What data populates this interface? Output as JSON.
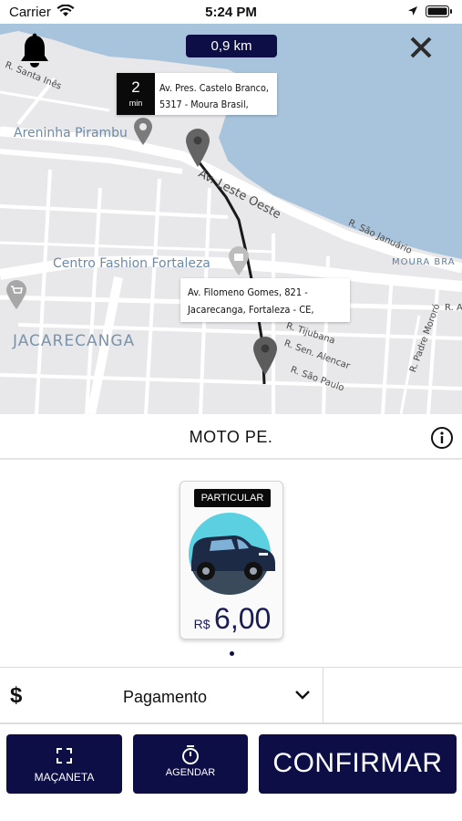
{
  "status_bar": {
    "carrier": "Carrier",
    "time": "5:24 PM"
  },
  "map": {
    "distance": "0,9 km",
    "eta": {
      "value": "2",
      "unit": "min"
    },
    "pickup_address": {
      "line1": "Av. Pres. Castelo Branco,",
      "line2": "5317 - Moura Brasil,"
    },
    "destination_address": {
      "line1": "Av. Filomeno Gomes, 821 -",
      "line2": "Jacarecanga, Fortaleza - CE,"
    },
    "labels": {
      "santa_ines": "R. Santa Inês",
      "areninha": "Areninha Pirambu",
      "leste_oeste": "Av. Leste Oeste",
      "sao_januario": "R. São Januário",
      "centro_fashion": "Centro Fashion Fortaleza",
      "moura_brasil": "MOURA BRA",
      "jacarecanga": "JACARECANGA",
      "tijubana": "R. Tijubana",
      "sen_alencar": "R. Sen. Alencar",
      "sao_paulo": "R. São Paulo",
      "padre_mororo": "R. Padre Mororó",
      "r_a": "R. A"
    }
  },
  "service": {
    "title": "MOTO PE."
  },
  "vehicle_card": {
    "badge": "PARTICULAR",
    "currency": "R$",
    "price": "6,00"
  },
  "payment": {
    "symbol": "$",
    "label": "Pagamento"
  },
  "actions": {
    "macaneta": "MAÇANETA",
    "agendar": "AGENDAR",
    "confirm": "CONFIRMAR"
  },
  "colors": {
    "primary": "#0d0e45",
    "water": "#a8c4dd",
    "map_bg": "#e8e8ea",
    "pin": "#6b6b6b"
  }
}
